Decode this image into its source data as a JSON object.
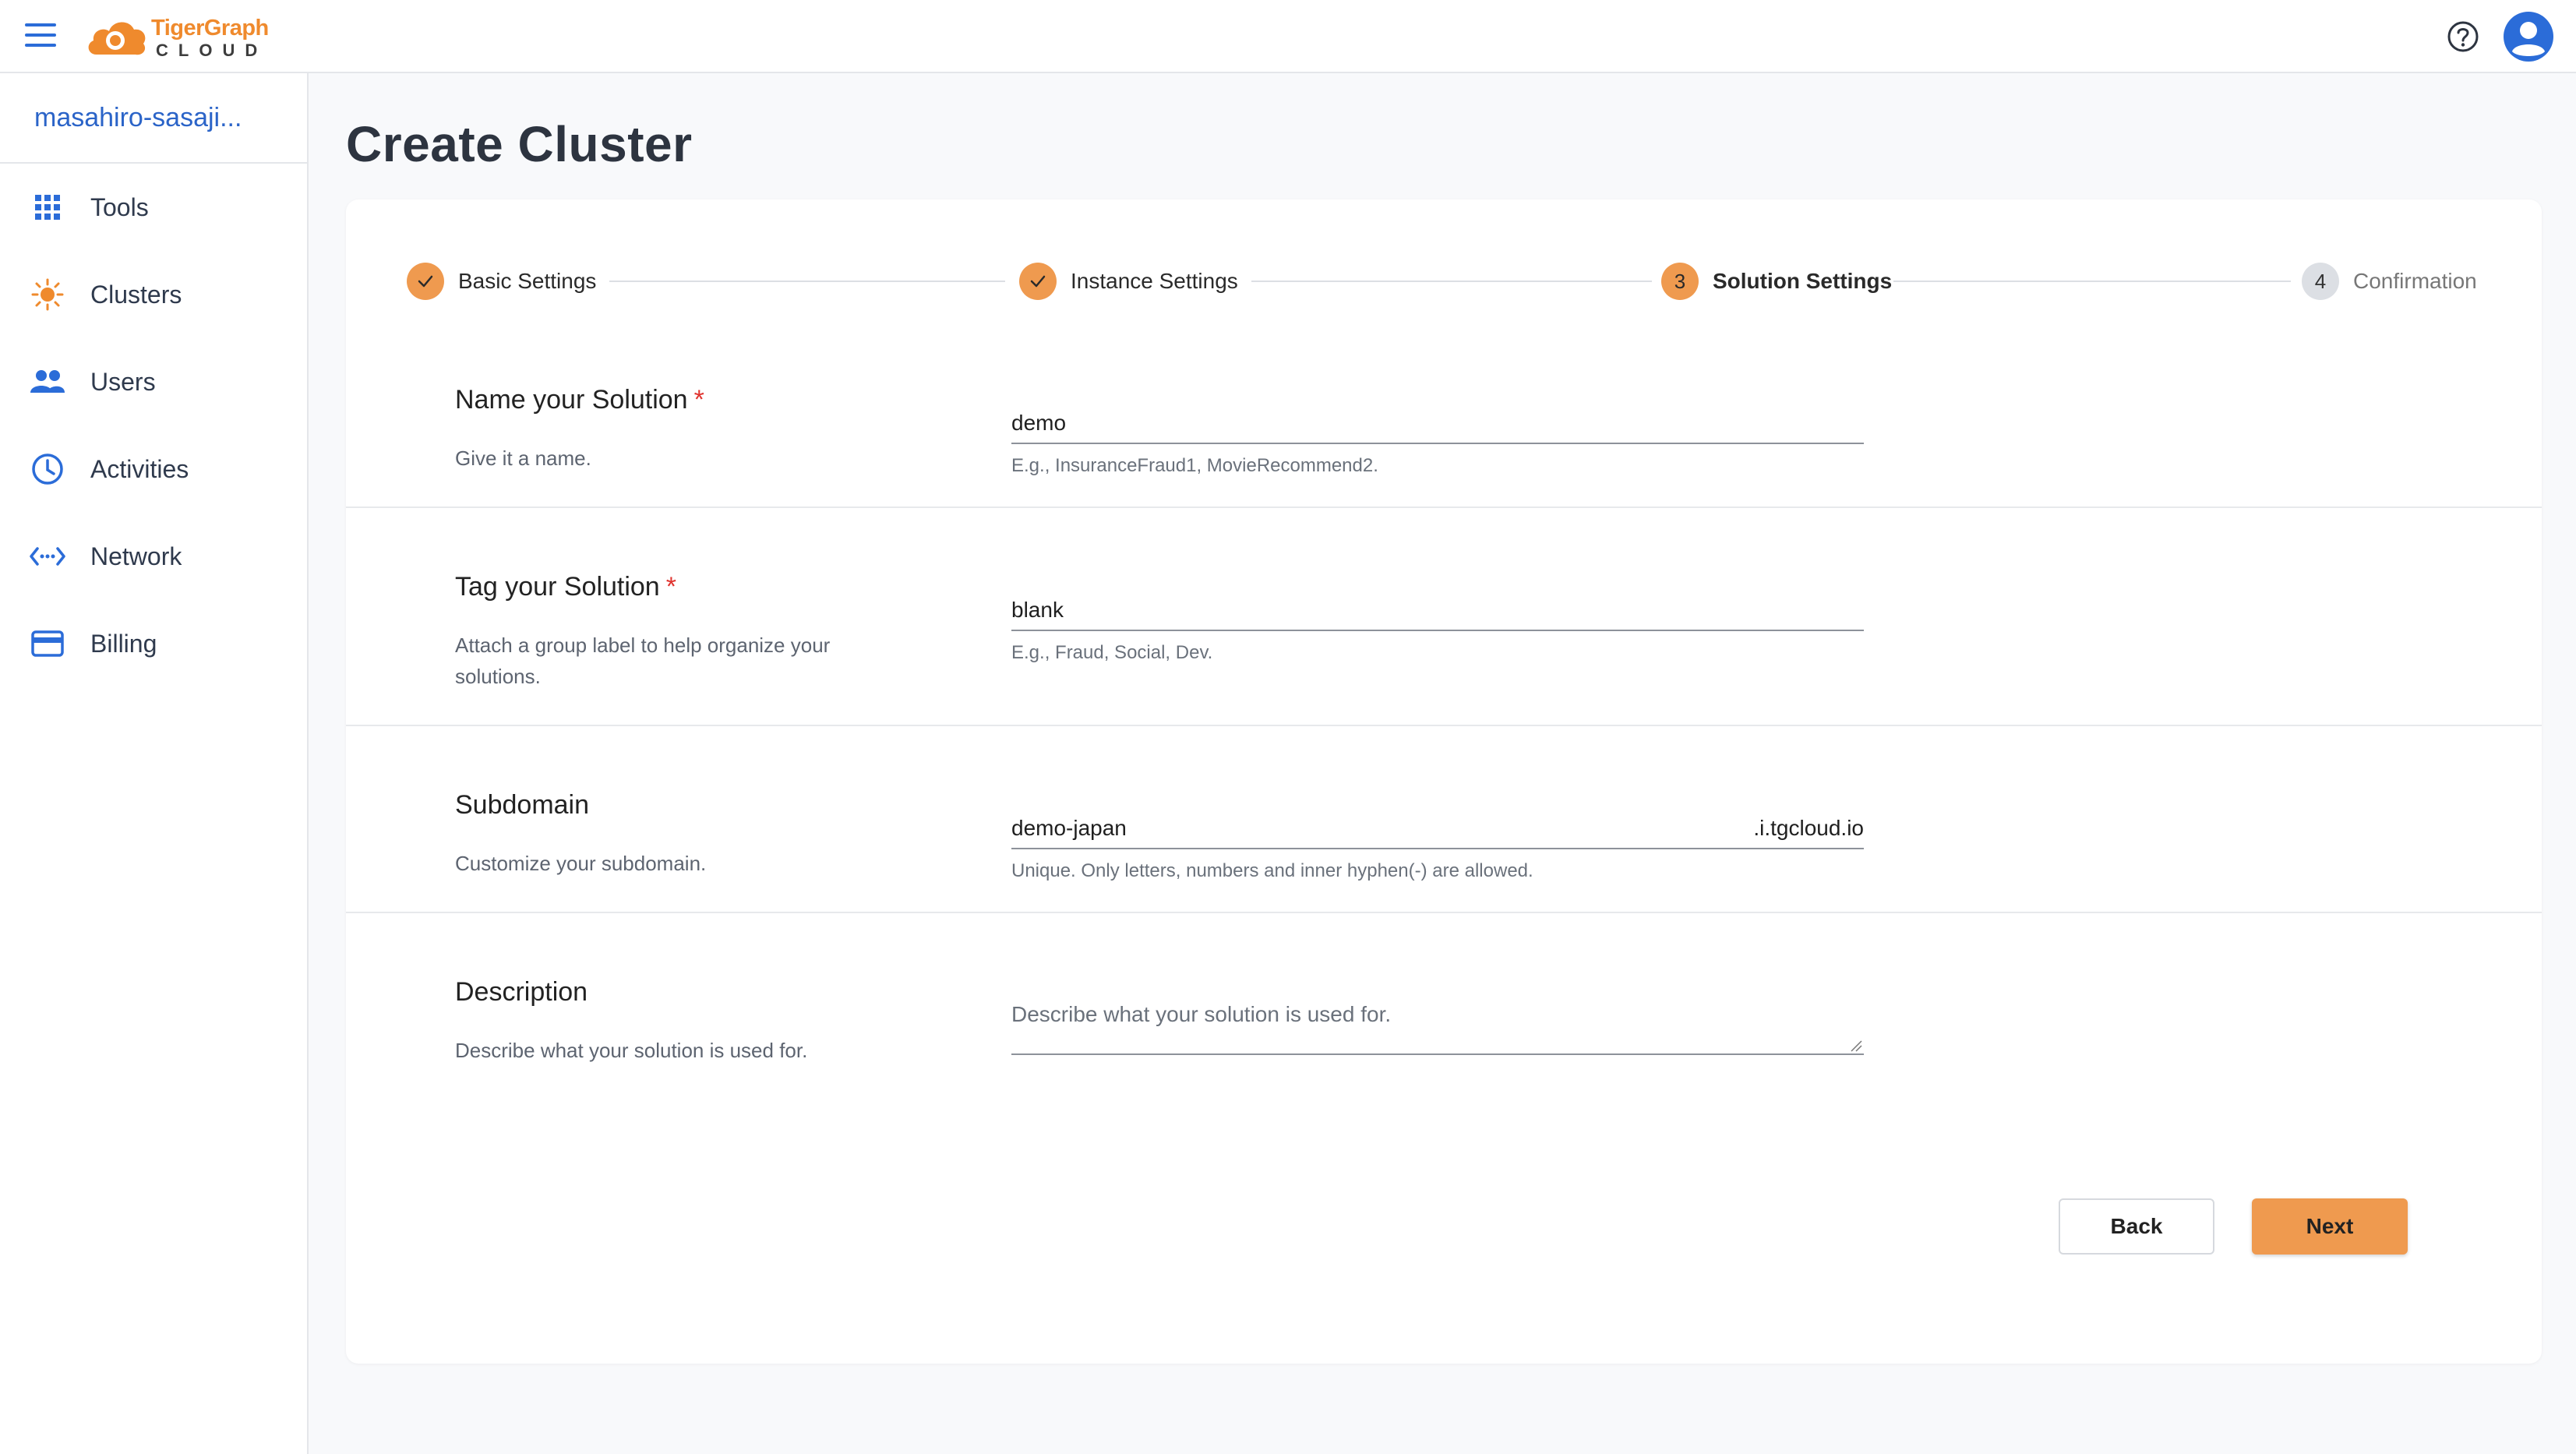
{
  "header": {
    "logo_brand": "TigerGraph",
    "logo_sub": "CLOUD",
    "icons": [
      "menu-icon",
      "help-icon",
      "account-icon"
    ]
  },
  "sidebar": {
    "org": "masahiro-sasaji...",
    "items": [
      {
        "label": "Tools",
        "icon": "grid-icon"
      },
      {
        "label": "Clusters",
        "icon": "cluster-icon"
      },
      {
        "label": "Users",
        "icon": "users-icon"
      },
      {
        "label": "Activities",
        "icon": "clock-icon"
      },
      {
        "label": "Network",
        "icon": "network-icon"
      },
      {
        "label": "Billing",
        "icon": "credit-card-icon"
      }
    ]
  },
  "page": {
    "title": "Create Cluster"
  },
  "stepper": {
    "steps": [
      {
        "label": "Basic Settings",
        "status": "done",
        "number": "1"
      },
      {
        "label": "Instance Settings",
        "status": "done",
        "number": "2"
      },
      {
        "label": "Solution Settings",
        "status": "active",
        "number": "3"
      },
      {
        "label": "Confirmation",
        "status": "pending",
        "number": "4"
      }
    ]
  },
  "form": {
    "name": {
      "title": "Name your Solution",
      "required": "*",
      "description": "Give it a name.",
      "value": "demo",
      "help": "E.g., InsuranceFraud1, MovieRecommend2."
    },
    "tag": {
      "title": "Tag your Solution",
      "required": "*",
      "description": "Attach a group label to help organize your solutions.",
      "value": "blank",
      "help": "E.g., Fraud, Social, Dev."
    },
    "subdomain": {
      "title": "Subdomain",
      "description": "Customize your subdomain.",
      "value": "demo-japan",
      "suffix": ".i.tgcloud.io",
      "help": "Unique. Only letters, numbers and inner hyphen(-) are allowed."
    },
    "description": {
      "title": "Description",
      "description": "Describe what your solution is used for.",
      "placeholder": "Describe what your solution is used for."
    }
  },
  "actions": {
    "back": "Back",
    "next": "Next"
  },
  "colors": {
    "accent_orange": "#ef9a4f",
    "brand_blue": "#2b6cd8",
    "required_red": "#e0342f"
  }
}
